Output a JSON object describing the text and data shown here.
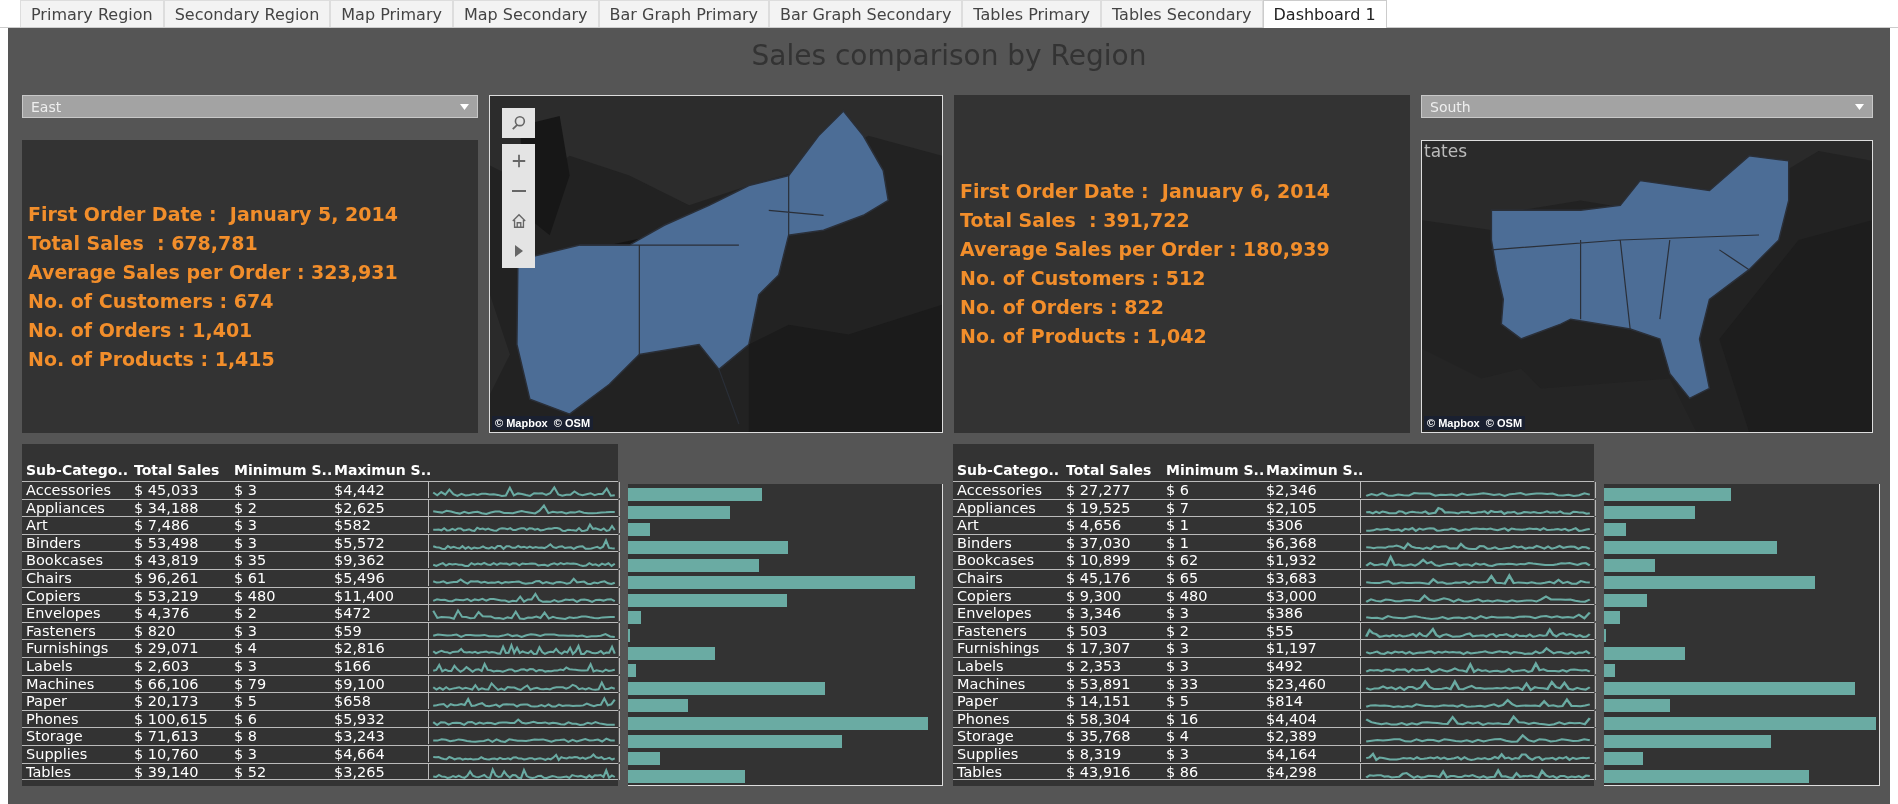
{
  "tabs": [
    {
      "label": "Primary Region",
      "selected": false
    },
    {
      "label": "Secondary Region",
      "selected": false
    },
    {
      "label": "Map Primary",
      "selected": false
    },
    {
      "label": "Map Secondary",
      "selected": false
    },
    {
      "label": "Bar Graph Primary",
      "selected": false
    },
    {
      "label": "Bar Graph Secondary",
      "selected": false
    },
    {
      "label": "Tables Primary",
      "selected": false
    },
    {
      "label": "Tables Secondary",
      "selected": false
    },
    {
      "label": "Dashboard 1",
      "selected": true
    }
  ],
  "title": "Sales comparison by Region",
  "regions": [
    {
      "filter": "East",
      "info": [
        "First Order Date :  January 5, 2014",
        "Total Sales  : 678,781",
        "Average Sales per Order : 323,931",
        "No. of Customers : 674",
        "No. of Orders : 1,401",
        "No. of Products : 1,415"
      ],
      "map": {
        "kind": "picture",
        "controls": true,
        "attribution": "© Mapbox  © OSM"
      },
      "table": {
        "columns": [
          "Sub-Catego..",
          "Total Sales",
          "Minimum S..",
          "Maximun S.."
        ],
        "rows": [
          {
            "cells": [
              "Accessories",
              "$ 45,033",
              "$ 3",
              "$4,442"
            ]
          },
          {
            "cells": [
              "Appliances",
              "$ 34,188",
              "$ 2",
              "$2,625"
            ]
          },
          {
            "cells": [
              "Art",
              "$ 7,486",
              "$ 3",
              "$582"
            ]
          },
          {
            "cells": [
              "Binders",
              "$ 53,498",
              "$ 3",
              "$5,572"
            ]
          },
          {
            "cells": [
              "Bookcases",
              "$ 43,819",
              "$ 35",
              "$9,362"
            ]
          },
          {
            "cells": [
              "Chairs",
              "$ 96,261",
              "$ 61",
              "$5,496"
            ]
          },
          {
            "cells": [
              "Copiers",
              "$ 53,219",
              "$ 480",
              "$11,400"
            ]
          },
          {
            "cells": [
              "Envelopes",
              "$ 4,376",
              "$ 2",
              "$472"
            ]
          },
          {
            "cells": [
              "Fasteners",
              "$ 820",
              "$ 3",
              "$59"
            ]
          },
          {
            "cells": [
              "Furnishings",
              "$ 29,071",
              "$ 4",
              "$2,816"
            ]
          },
          {
            "cells": [
              "Labels",
              "$ 2,603",
              "$ 3",
              "$166"
            ]
          },
          {
            "cells": [
              "Machines",
              "$ 66,106",
              "$ 79",
              "$9,100"
            ]
          },
          {
            "cells": [
              "Paper",
              "$ 20,173",
              "$ 5",
              "$658"
            ]
          },
          {
            "cells": [
              "Phones",
              "$ 100,615",
              "$ 6",
              "$5,932"
            ]
          },
          {
            "cells": [
              "Storage",
              "$ 71,613",
              "$ 8",
              "$3,243"
            ]
          },
          {
            "cells": [
              "Supplies",
              "$ 10,760",
              "$ 3",
              "$4,664"
            ]
          },
          {
            "cells": [
              "Tables",
              "$ 39,140",
              "$ 52",
              "$3,265"
            ]
          }
        ]
      }
    },
    {
      "filter": "South",
      "info": [
        "First Order Date :  January 6, 2014",
        "Total Sales  : 391,722",
        "Average Sales per Order : 180,939",
        "No. of Customers : 512",
        "No. of Orders : 822",
        "No. of Products : 1,042"
      ],
      "map": {
        "kind": "picture",
        "controls": false,
        "label": "tates",
        "attribution": "© Mapbox  © OSM"
      },
      "table": {
        "columns": [
          "Sub-Catego..",
          "Total Sales",
          "Minimum S..",
          "Maximun S.."
        ],
        "rows": [
          {
            "cells": [
              "Accessories",
              "$ 27,277",
              "$ 6",
              "$2,346"
            ]
          },
          {
            "cells": [
              "Appliances",
              "$ 19,525",
              "$ 7",
              "$2,105"
            ]
          },
          {
            "cells": [
              "Art",
              "$ 4,656",
              "$ 1",
              "$306"
            ]
          },
          {
            "cells": [
              "Binders",
              "$ 37,030",
              "$ 1",
              "$6,368"
            ]
          },
          {
            "cells": [
              "Bookcases",
              "$ 10,899",
              "$ 62",
              "$1,932"
            ]
          },
          {
            "cells": [
              "Chairs",
              "$ 45,176",
              "$ 65",
              "$3,683"
            ]
          },
          {
            "cells": [
              "Copiers",
              "$ 9,300",
              "$ 480",
              "$3,000"
            ]
          },
          {
            "cells": [
              "Envelopes",
              "$ 3,346",
              "$ 3",
              "$386"
            ]
          },
          {
            "cells": [
              "Fasteners",
              "$ 503",
              "$ 2",
              "$55"
            ]
          },
          {
            "cells": [
              "Furnishings",
              "$ 17,307",
              "$ 3",
              "$1,197"
            ]
          },
          {
            "cells": [
              "Labels",
              "$ 2,353",
              "$ 3",
              "$492"
            ]
          },
          {
            "cells": [
              "Machines",
              "$ 53,891",
              "$ 33",
              "$23,460"
            ]
          },
          {
            "cells": [
              "Paper",
              "$ 14,151",
              "$ 5",
              "$814"
            ]
          },
          {
            "cells": [
              "Phones",
              "$ 58,304",
              "$ 16",
              "$4,404"
            ]
          },
          {
            "cells": [
              "Storage",
              "$ 35,768",
              "$ 4",
              "$2,389"
            ]
          },
          {
            "cells": [
              "Supplies",
              "$ 8,319",
              "$ 3",
              "$4,164"
            ]
          },
          {
            "cells": [
              "Tables",
              "$ 43,916",
              "$ 86",
              "$4,298"
            ]
          }
        ]
      }
    }
  ]
}
